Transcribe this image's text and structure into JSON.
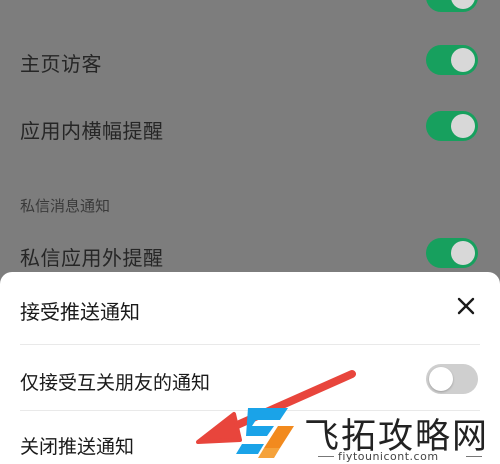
{
  "settings": {
    "rows": [
      {
        "label": "主页访客",
        "enabled": true
      },
      {
        "label": "应用内横幅提醒",
        "enabled": true
      }
    ],
    "section_title": "私信消息通知",
    "section_rows": [
      {
        "label": "私信应用外提醒",
        "enabled": true
      }
    ]
  },
  "sheet": {
    "title": "接受推送通知",
    "options": [
      {
        "label": "仅接受互关朋友的通知",
        "enabled": false
      },
      {
        "label": "关闭推送通知"
      }
    ]
  },
  "watermark": {
    "name": "飞拓攻略网",
    "url": "fiytounicont.com"
  },
  "colors": {
    "toggle_on": "#17a05e",
    "toggle_off": "#cfcfcf",
    "arrow": "#e8453c",
    "overlay_bg": "#7d7d7d"
  }
}
